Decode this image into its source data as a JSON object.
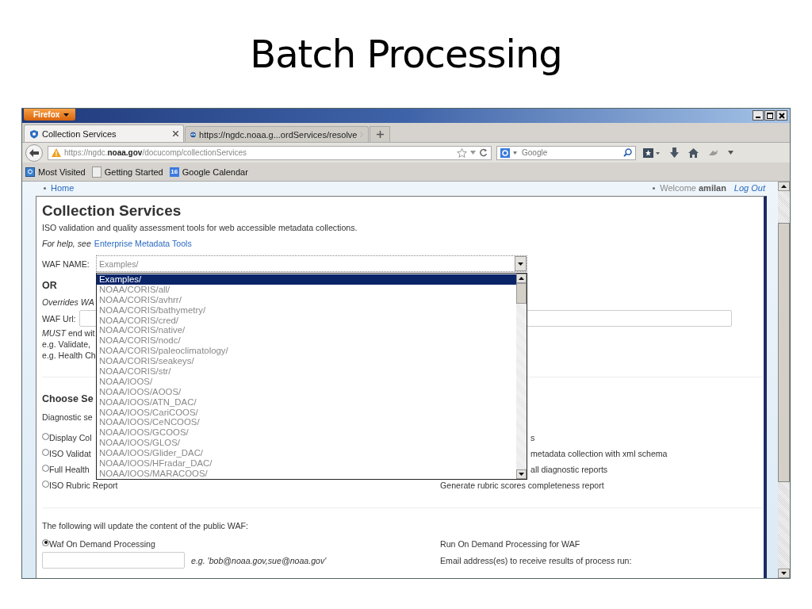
{
  "slide_title": "Batch Processing",
  "browser": {
    "app_button": "Firefox",
    "tabs": [
      {
        "label": "Collection Services",
        "selected": true
      },
      {
        "label": "https://ngdc.noaa.g...ordServices/resolve",
        "selected": false
      }
    ],
    "address": "https://ngdc.**noaa.gov**/docucomp/collectionServices",
    "search": {
      "placeholder": "Google"
    },
    "bookmarks": [
      {
        "label": "Most Visited",
        "kind": "folder"
      },
      {
        "label": "Getting Started",
        "kind": "blank"
      },
      {
        "label": "Google Calendar",
        "kind": "calendar",
        "icon_text": "16"
      }
    ]
  },
  "page": {
    "nav_link": "Home",
    "welcome": "Welcome **amilan**",
    "logout": "Log Out",
    "heading": "Collection Services",
    "intro": "ISO validation and quality assessment tools for web accessible metadata collections.",
    "help_prefix": "For help, see",
    "help_link": "Enterprise Metadata Tools",
    "waf_name": {
      "label": "WAF NAME:",
      "value": "Examples/",
      "options": [
        {
          "label": "Examples/",
          "selected": true
        },
        {
          "label": "NOAA/CORIS/all/",
          "selected": false
        },
        {
          "label": "NOAA/CORIS/avhrr/",
          "selected": false
        },
        {
          "label": "NOAA/CORIS/bathymetry/",
          "selected": false
        },
        {
          "label": "NOAA/CORIS/cred/",
          "selected": false
        },
        {
          "label": "NOAA/CORIS/native/",
          "selected": false
        },
        {
          "label": "NOAA/CORIS/nodc/",
          "selected": false
        },
        {
          "label": "NOAA/CORIS/paleoclimatology/",
          "selected": false
        },
        {
          "label": "NOAA/CORIS/seakeys/",
          "selected": false
        },
        {
          "label": "NOAA/CORIS/str/",
          "selected": false
        },
        {
          "label": "NOAA/IOOS/",
          "selected": false
        },
        {
          "label": "NOAA/IOOS/AOOS/",
          "selected": false
        },
        {
          "label": "NOAA/IOOS/ATN_DAC/",
          "selected": false
        },
        {
          "label": "NOAA/IOOS/CariCOOS/",
          "selected": false
        },
        {
          "label": "NOAA/IOOS/CeNCOOS/",
          "selected": false
        },
        {
          "label": "NOAA/IOOS/GCOOS/",
          "selected": false
        },
        {
          "label": "NOAA/IOOS/GLOS/",
          "selected": false
        },
        {
          "label": "NOAA/IOOS/Glider_DAC/",
          "selected": false
        },
        {
          "label": "NOAA/IOOS/HFradar_DAC/",
          "selected": false
        },
        {
          "label": "NOAA/IOOS/MARACOOS/",
          "selected": false
        }
      ]
    },
    "or_heading": "OR",
    "overrides_note": "Overrides WA",
    "waf_url_label": "WAF Url:",
    "must_note": "*MUST* end wit",
    "examples": [
      "e.g. Validate,",
      "e.g. Health Ch"
    ],
    "section_heading": "Choose Se",
    "section_note": "Diagnostic se",
    "services": [
      {
        "label": "Display Col",
        "description": "s",
        "selected": false,
        "partly_hidden": true
      },
      {
        "label": "ISO Validat",
        "description": "metadata collection with xml schema",
        "selected": false,
        "partly_hidden": true
      },
      {
        "label": "Full Health",
        "description": "all diagnostic reports",
        "selected": false,
        "partly_hidden": true
      },
      {
        "label": "ISO Rubric Report",
        "description": "Generate rubric scores completeness report",
        "selected": false
      }
    ],
    "public_note": "The following will update the content of the public WAF:",
    "on_demand": {
      "label": "Waf On Demand Processing",
      "selected": true,
      "description": "Run On Demand Processing for WAF",
      "email_hint": "e.g. 'bob@noaa.gov,sue@noaa.gov'",
      "email_description": "Email address(es) to receive results of process run:"
    }
  }
}
